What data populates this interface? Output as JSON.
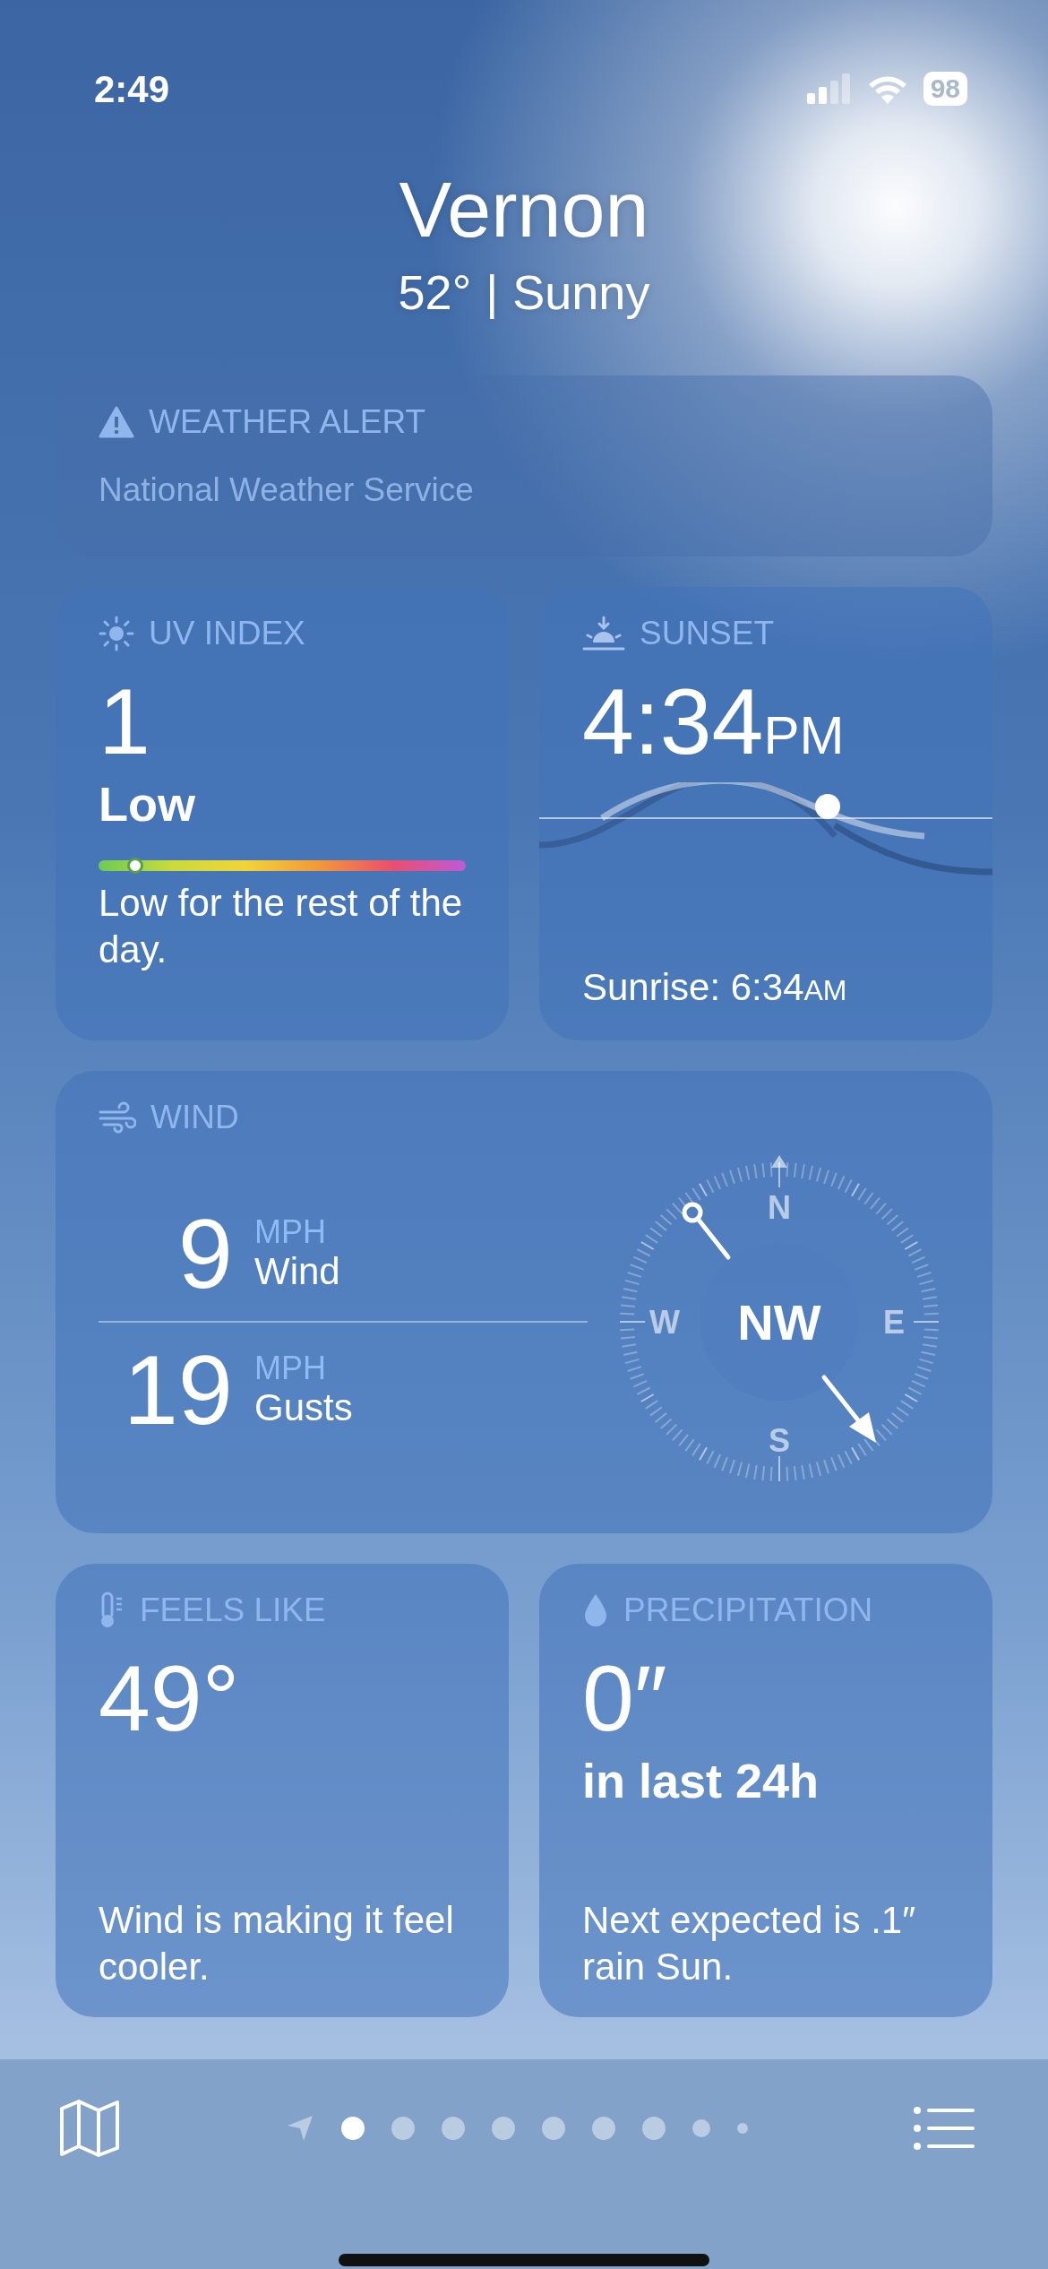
{
  "status_bar": {
    "time": "2:49",
    "battery": "98"
  },
  "location": {
    "city": "Vernon",
    "temperature": "52°",
    "separator": "|",
    "condition": "Sunny"
  },
  "alert": {
    "title": "WEATHER ALERT",
    "source": "National Weather Service"
  },
  "uv": {
    "title": "UV INDEX",
    "value": "1",
    "category": "Low",
    "level": 0.1,
    "description": "Low for the rest of the day."
  },
  "sunset": {
    "title": "SUNSET",
    "time": "4:34",
    "suffix": "PM",
    "sunrise_label": "Sunrise: 6:34",
    "sunrise_suffix": "AM"
  },
  "wind": {
    "title": "WIND",
    "rows": [
      {
        "value": "9",
        "unit": "MPH",
        "label": "Wind"
      },
      {
        "value": "19",
        "unit": "MPH",
        "label": "Gusts"
      }
    ],
    "compass": {
      "direction": "NW",
      "north": "N",
      "east": "E",
      "south": "S",
      "west": "W"
    }
  },
  "feels_like": {
    "title": "FEELS LIKE",
    "value": "49°",
    "description": "Wind is making it feel cooler."
  },
  "precipitation": {
    "title": "PRECIPITATION",
    "value": "0″",
    "period": "in last 24h",
    "description": "Next expected is .1″ rain Sun."
  },
  "page_dots": [
    {
      "kind": "location",
      "selected": false
    },
    {
      "kind": "dot",
      "selected": true
    },
    {
      "kind": "dot",
      "selected": false
    },
    {
      "kind": "dot",
      "selected": false
    },
    {
      "kind": "dot",
      "selected": false
    },
    {
      "kind": "dot",
      "selected": false
    },
    {
      "kind": "dot",
      "selected": false
    },
    {
      "kind": "dot",
      "selected": false
    },
    {
      "kind": "small",
      "selected": false
    },
    {
      "kind": "tiny",
      "selected": false
    }
  ]
}
